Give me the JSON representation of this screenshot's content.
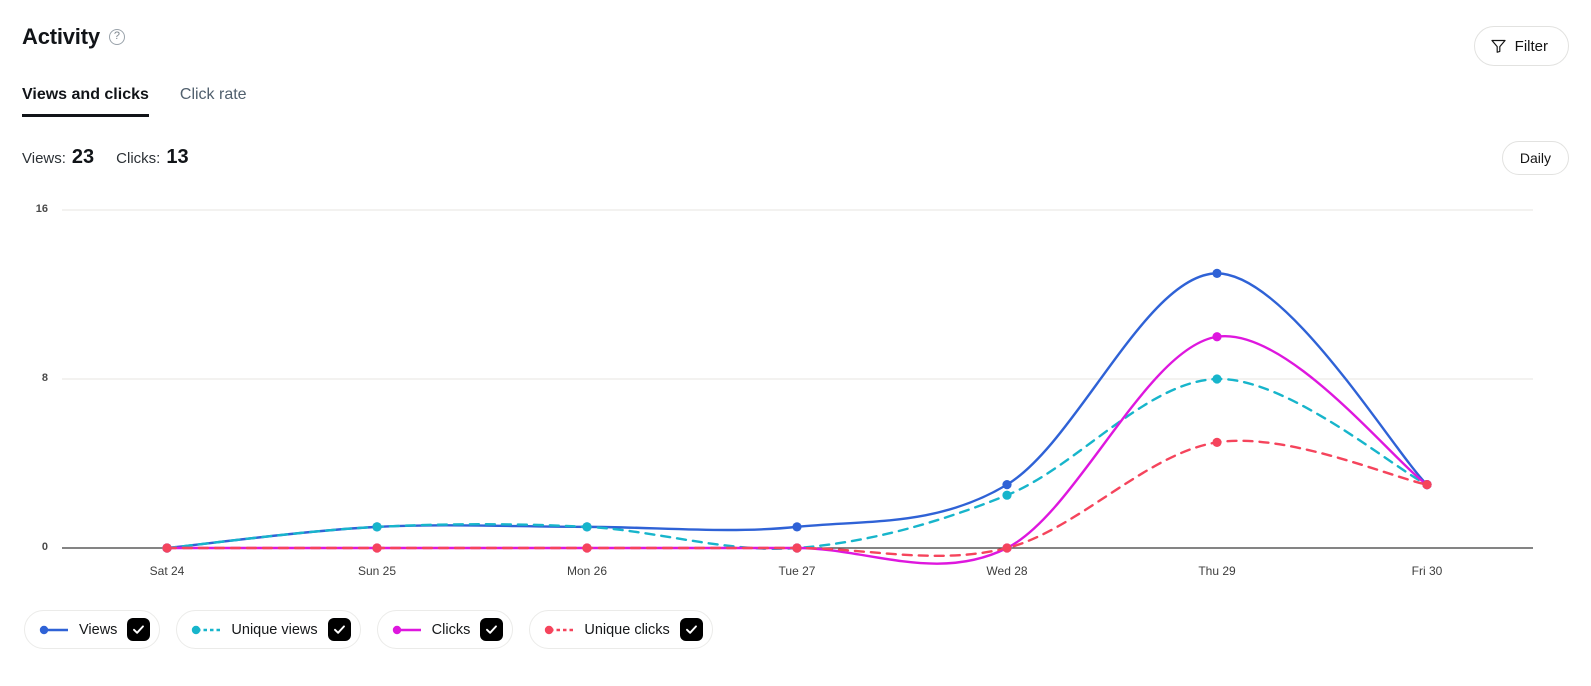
{
  "header": {
    "title": "Activity",
    "help_icon": "help-circle-icon",
    "filter_label": "Filter",
    "filter_icon": "funnel-icon"
  },
  "tabs": [
    {
      "label": "Views and clicks",
      "active": true
    },
    {
      "label": "Click rate",
      "active": false
    }
  ],
  "summary": {
    "views_label": "Views:",
    "views_value": "23",
    "clicks_label": "Clicks:",
    "clicks_value": "13"
  },
  "granularity": {
    "label": "Daily"
  },
  "legend": [
    {
      "label": "Views",
      "color": "#2f62d6",
      "style": "solid",
      "checked": true
    },
    {
      "label": "Unique views",
      "color": "#17b5cb",
      "style": "dashed",
      "checked": true
    },
    {
      "label": "Clicks",
      "color": "#de17de",
      "style": "solid",
      "checked": true
    },
    {
      "label": "Unique clicks",
      "color": "#f5445c",
      "style": "dashed",
      "checked": true
    }
  ],
  "chart_data": {
    "type": "line",
    "title": "Activity",
    "xlabel": "",
    "ylabel": "",
    "categories": [
      "Sat 24",
      "Sun 25",
      "Mon 26",
      "Tue 27",
      "Wed 28",
      "Thu 29",
      "Fri 30"
    ],
    "yticks": [
      "0",
      "8",
      "16"
    ],
    "ylim": [
      0,
      16
    ],
    "grid": true,
    "legend_position": "bottom",
    "series": [
      {
        "name": "Views",
        "color": "#2f62d6",
        "style": "solid",
        "values": [
          0,
          1,
          1,
          1,
          3,
          13,
          3
        ]
      },
      {
        "name": "Unique views",
        "color": "#17b5cb",
        "style": "dashed",
        "values": [
          0,
          1,
          1,
          0,
          2.5,
          8,
          3
        ]
      },
      {
        "name": "Clicks",
        "color": "#de17de",
        "style": "solid",
        "values": [
          0,
          0,
          0,
          0,
          0,
          10,
          3
        ]
      },
      {
        "name": "Unique clicks",
        "color": "#f5445c",
        "style": "dashed",
        "values": [
          0,
          0,
          0,
          0,
          0,
          5,
          3
        ]
      }
    ]
  }
}
